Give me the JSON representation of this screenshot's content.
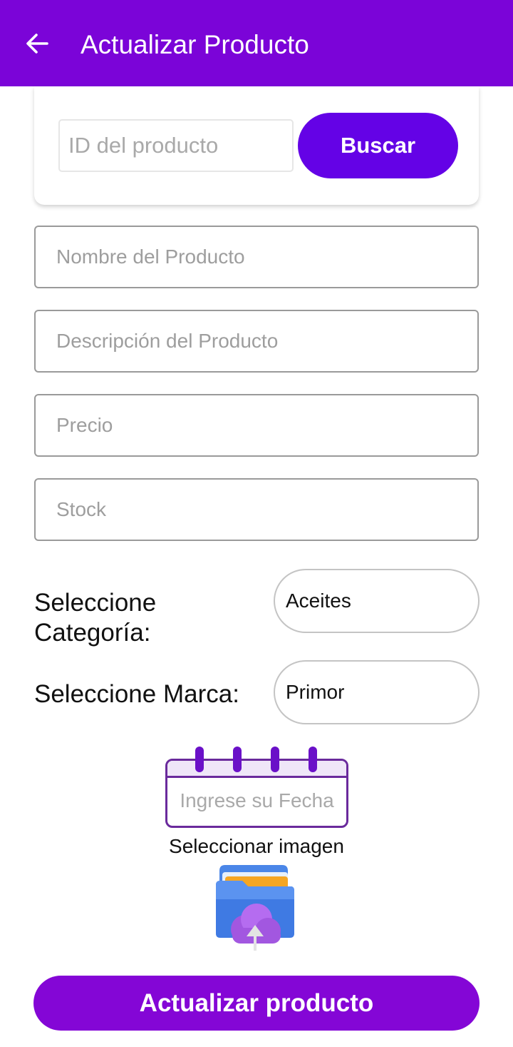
{
  "header": {
    "title": "Actualizar Producto",
    "back_icon": "arrow-left-icon",
    "background": "#7b04d8"
  },
  "search": {
    "id_placeholder": "ID del producto",
    "id_value": "",
    "button_label": "Buscar",
    "button_color": "#6402e6"
  },
  "form": {
    "name_placeholder": "Nombre del Producto",
    "description_placeholder": "Descripción del Producto",
    "price_placeholder": "Precio",
    "stock_placeholder": "Stock",
    "category_label": "Seleccione Categoría:",
    "category_value": "Aceites",
    "brand_label": "Seleccione Marca:",
    "brand_value": "Primor",
    "date_placeholder": "Ingrese su Fecha",
    "date_icon": "calendar-icon",
    "image_label": "Seleccionar imagen",
    "image_icon": "folder-upload-icon"
  },
  "actions": {
    "update_label": "Actualizar producto",
    "update_color": "#8406d6"
  }
}
